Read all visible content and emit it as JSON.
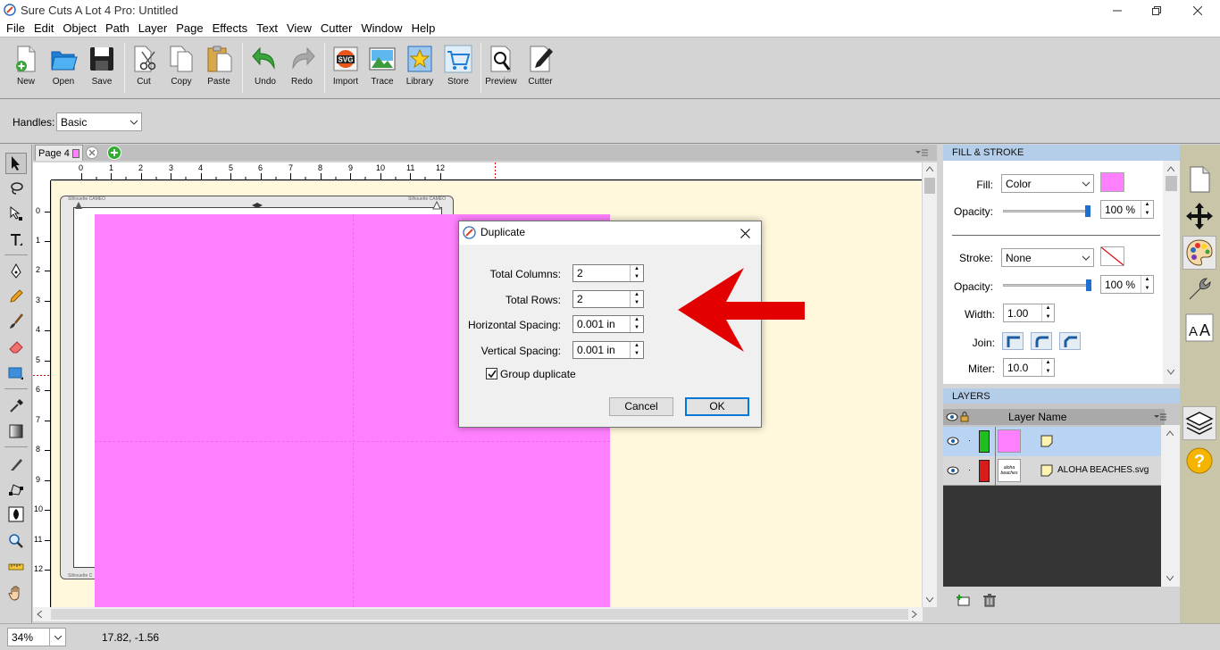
{
  "window": {
    "title": "Sure Cuts A Lot 4 Pro: Untitled"
  },
  "menu": [
    "File",
    "Edit",
    "Object",
    "Path",
    "Layer",
    "Page",
    "Effects",
    "Text",
    "View",
    "Cutter",
    "Window",
    "Help"
  ],
  "toolbar": {
    "new": "New",
    "open": "Open",
    "save": "Save",
    "cut": "Cut",
    "copy": "Copy",
    "paste": "Paste",
    "undo": "Undo",
    "redo": "Redo",
    "import": "Import",
    "trace": "Trace",
    "library": "Library",
    "store": "Store",
    "preview": "Preview",
    "cutter": "Cutter",
    "import_icon_text": "SVG"
  },
  "handles": {
    "label": "Handles:",
    "value": "Basic"
  },
  "page_tab": {
    "label": "Page 4",
    "color": "#ff80ff"
  },
  "ruler": {
    "h_ticks": [
      "0",
      "1",
      "2",
      "3",
      "4",
      "5",
      "6",
      "7",
      "8",
      "9",
      "10",
      "11",
      "12"
    ],
    "v_ticks": [
      "0",
      "1",
      "2",
      "3",
      "4",
      "5",
      "6",
      "7",
      "8",
      "9",
      "10",
      "11",
      "12"
    ]
  },
  "mat": {
    "brand_left": "Silhouette CAMEO",
    "brand_right": "Silhouette CAMEO",
    "brand_bottom": "Silhouette C"
  },
  "design": {
    "fill_color": "#ff80ff"
  },
  "dialog": {
    "title": "Duplicate",
    "total_columns_label": "Total Columns:",
    "total_columns": "2",
    "total_rows_label": "Total Rows:",
    "total_rows": "2",
    "h_spacing_label": "Horizontal Spacing:",
    "h_spacing": "0.001 in",
    "v_spacing_label": "Vertical Spacing:",
    "v_spacing": "0.001 in",
    "group_label": "Group duplicate",
    "group_checked": true,
    "cancel": "Cancel",
    "ok": "OK"
  },
  "fill_stroke": {
    "header": "FILL & STROKE",
    "fill_label": "Fill:",
    "fill_type": "Color",
    "fill_color": "#ff80ff",
    "opacity_label": "Opacity:",
    "fill_opacity": "100 %",
    "stroke_label": "Stroke:",
    "stroke_type": "None",
    "stroke_opacity_label": "Opacity:",
    "stroke_opacity": "100 %",
    "width_label": "Width:",
    "width": "1.00",
    "join_label": "Join:",
    "miter_label": "Miter:",
    "miter": "10.0"
  },
  "layers": {
    "header": "LAYERS",
    "column": "Layer Name",
    "rows": [
      {
        "name": "",
        "color": "#1fbf1f",
        "thumb_color": "#ff80ff"
      },
      {
        "name": "ALOHA BEACHES.svg",
        "color": "#d81b1b",
        "thumb_text": "aloha beaches"
      }
    ]
  },
  "status": {
    "zoom": "34%",
    "coords": "17.82, -1.56"
  },
  "annotation": {
    "arrow_color": "#e30000"
  }
}
